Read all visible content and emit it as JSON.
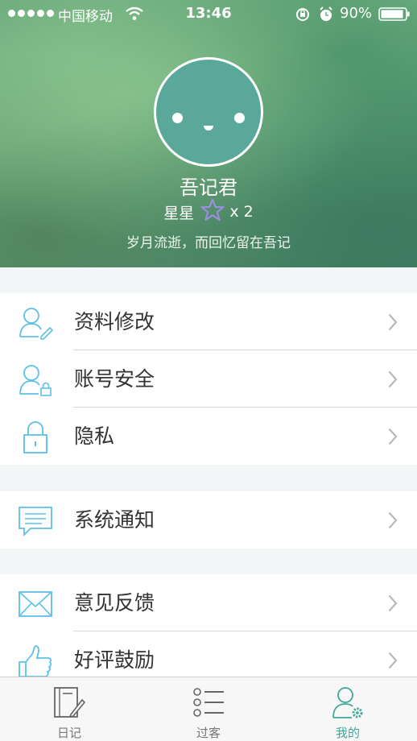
{
  "status_bar": {
    "carrier": "中国移动",
    "time": "13:46",
    "battery": "90%"
  },
  "profile": {
    "name": "吾记君",
    "stars_label": "星星",
    "stars_count": "x 2",
    "motto": "岁月流逝，而回忆留在吾记"
  },
  "menu": {
    "group1": [
      {
        "label": "资料修改",
        "icon": "user-edit-icon"
      },
      {
        "label": "账号安全",
        "icon": "user-lock-icon"
      },
      {
        "label": "隐私",
        "icon": "lock-icon"
      }
    ],
    "group2": [
      {
        "label": "系统通知",
        "icon": "message-icon"
      }
    ],
    "group3": [
      {
        "label": "意见反馈",
        "icon": "mail-icon"
      },
      {
        "label": "好评鼓励",
        "icon": "thumbs-up-icon"
      }
    ]
  },
  "tabbar": {
    "tabs": [
      {
        "label": "日记",
        "icon": "diary-icon",
        "active": false
      },
      {
        "label": "过客",
        "icon": "list-icon",
        "active": false
      },
      {
        "label": "我的",
        "icon": "user-settings-icon",
        "active": true
      }
    ]
  },
  "colors": {
    "accent": "#3fa79a",
    "icon_blue": "#5bc0e8",
    "avatar": "#5aa89a"
  }
}
